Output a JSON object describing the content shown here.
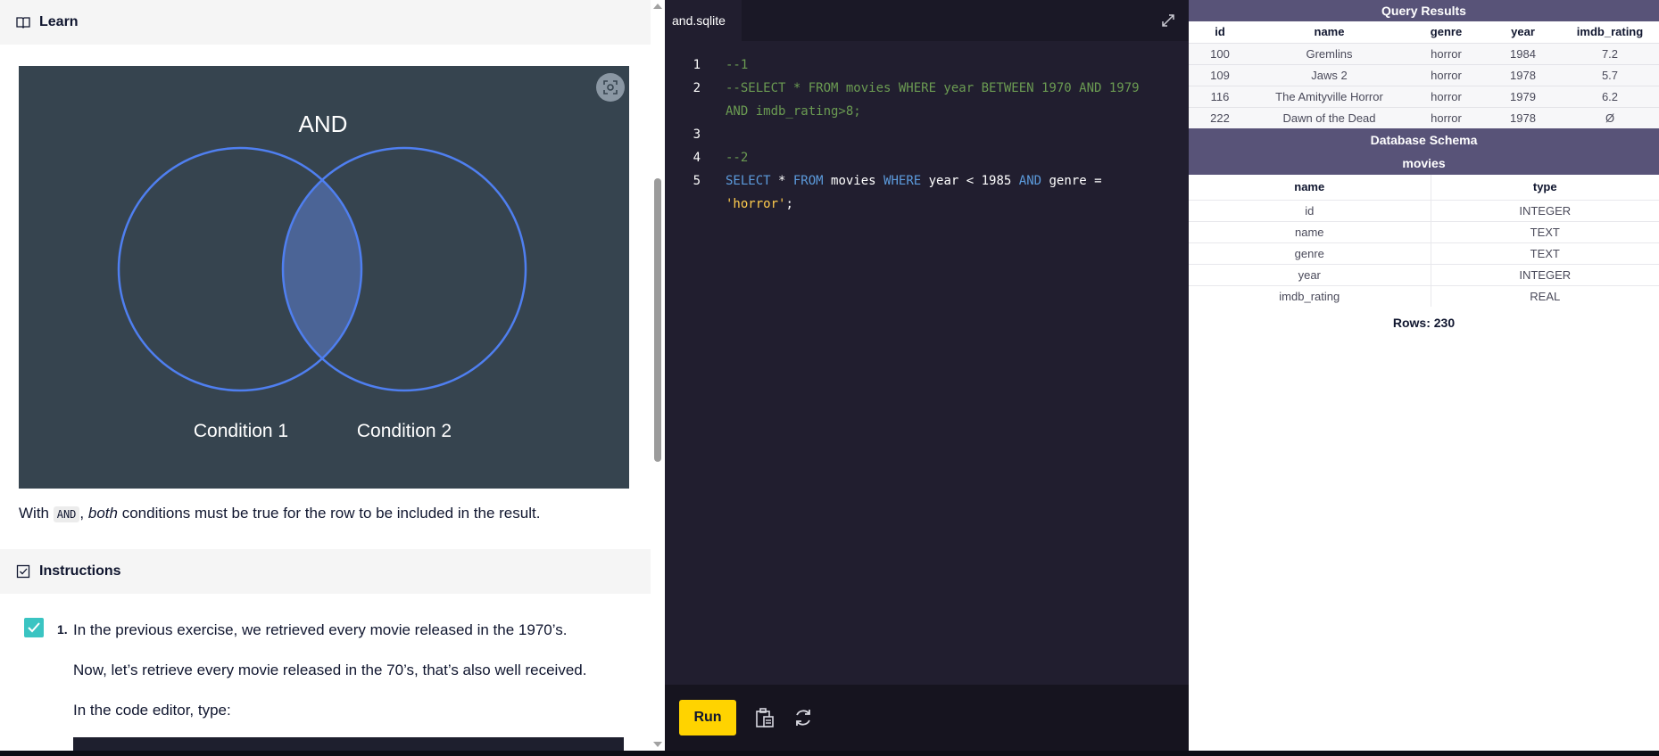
{
  "learn": {
    "title": "Learn",
    "figure": {
      "heading": "AND",
      "left_label": "Condition 1",
      "right_label": "Condition 2"
    },
    "description": {
      "prefix": "With",
      "code": "AND",
      "mid": ",",
      "emphasis": "both",
      "suffix": "conditions must be true for the row to be included in the result."
    }
  },
  "instructions": {
    "title": "Instructions",
    "step_number": "1.",
    "line1": "In the previous exercise, we retrieved every movie released in the 1970’s.",
    "line2": "Now, let’s retrieve every movie released in the 70’s, that’s also well received.",
    "line3": "In the code editor, type:"
  },
  "editor": {
    "tab": "and.sqlite",
    "lines": [
      {
        "n": "1",
        "text": "--1"
      },
      {
        "n": "2",
        "text": "--SELECT * FROM movies WHERE year BETWEEN 1970 AND 1979",
        "cont": "AND imdb_rating>8;"
      },
      {
        "n": "3",
        "text": ""
      },
      {
        "n": "4",
        "text": "--2"
      },
      {
        "n": "5",
        "t1": "SELECT",
        "t2": " * ",
        "t3": "FROM",
        "t4": " movies ",
        "t5": "WHERE",
        "t6": " year < 1985 ",
        "t7": "AND",
        "t8": " genre =",
        "cont": "'horror'",
        "cont_end": ";"
      }
    ],
    "run_label": "Run"
  },
  "results": {
    "title": "Query Results",
    "columns": [
      "id",
      "name",
      "genre",
      "year",
      "imdb_rating"
    ],
    "rows": [
      [
        "100",
        "Gremlins",
        "horror",
        "1984",
        "7.2"
      ],
      [
        "109",
        "Jaws 2",
        "horror",
        "1978",
        "5.7"
      ],
      [
        "116",
        "The Amityville Horror",
        "horror",
        "1979",
        "6.2"
      ],
      [
        "222",
        "Dawn of the Dead",
        "horror",
        "1978",
        "Ø"
      ]
    ],
    "schema_title": "Database Schema",
    "table_name": "movies",
    "schema_columns": [
      "name",
      "type"
    ],
    "schema_rows": [
      [
        "id",
        "INTEGER"
      ],
      [
        "name",
        "TEXT"
      ],
      [
        "genre",
        "TEXT"
      ],
      [
        "year",
        "INTEGER"
      ],
      [
        "imdb_rating",
        "REAL"
      ]
    ],
    "rows_count": "Rows: 230"
  },
  "colors": {
    "accent_header": "#585378",
    "run_button": "#ffd300",
    "checkbox": "#3ac4c2",
    "venn_stroke": "#4f7ff0"
  }
}
